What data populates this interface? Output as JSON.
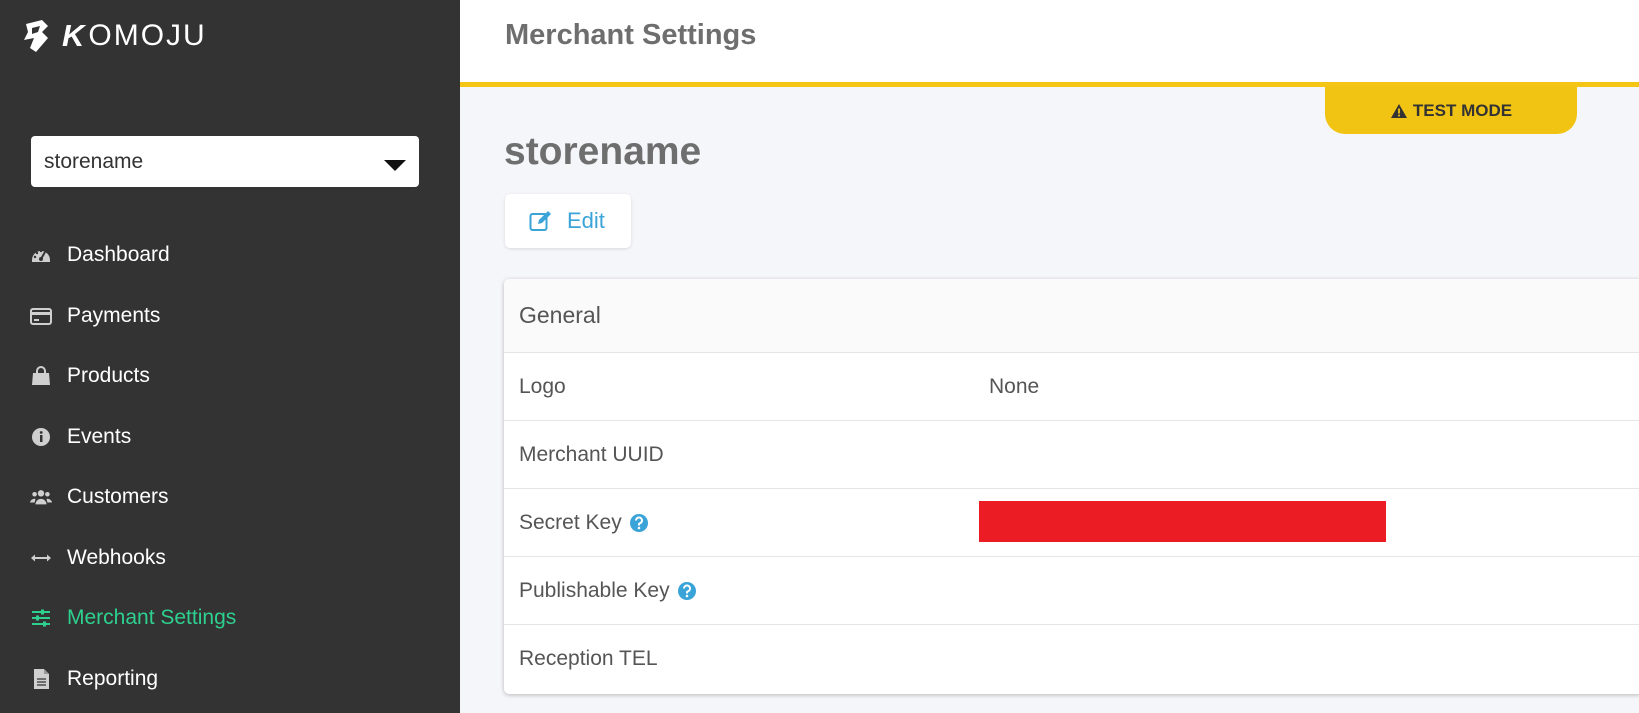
{
  "brand": {
    "name": "OMOJU",
    "k_letter": "K"
  },
  "store_selector": {
    "value": "storename"
  },
  "nav": {
    "items": [
      {
        "label": "Dashboard",
        "icon": "dashboard-gauge-icon",
        "active": false
      },
      {
        "label": "Payments",
        "icon": "credit-card-icon",
        "active": false
      },
      {
        "label": "Products",
        "icon": "shopping-bag-icon",
        "active": false
      },
      {
        "label": "Events",
        "icon": "info-circle-icon",
        "active": false
      },
      {
        "label": "Customers",
        "icon": "users-icon",
        "active": false
      },
      {
        "label": "Webhooks",
        "icon": "double-arrow-icon",
        "active": false
      },
      {
        "label": "Merchant Settings",
        "icon": "sliders-icon",
        "active": true
      },
      {
        "label": "Reporting",
        "icon": "document-icon",
        "active": false
      }
    ]
  },
  "header": {
    "title": "Merchant Settings"
  },
  "test_mode": {
    "label": "TEST MODE",
    "icon": "warning-triangle-icon"
  },
  "main": {
    "store_name": "storename",
    "edit_label": "Edit",
    "general_card": {
      "title": "General",
      "rows": [
        {
          "label": "Logo",
          "value": "None",
          "help": false
        },
        {
          "label": "Merchant UUID",
          "value": "",
          "help": false
        },
        {
          "label": "Secret Key",
          "value": "",
          "help": true,
          "redacted": true
        },
        {
          "label": "Publishable Key",
          "value": "",
          "help": true
        },
        {
          "label": "Reception TEL",
          "value": "",
          "help": false
        }
      ]
    }
  },
  "colors": {
    "sidebar_bg": "#333333",
    "active_nav": "#2ed08f",
    "accent_yellow": "#f4c514",
    "link_blue": "#3aa3d8",
    "redaction_red": "#ec1c24"
  }
}
